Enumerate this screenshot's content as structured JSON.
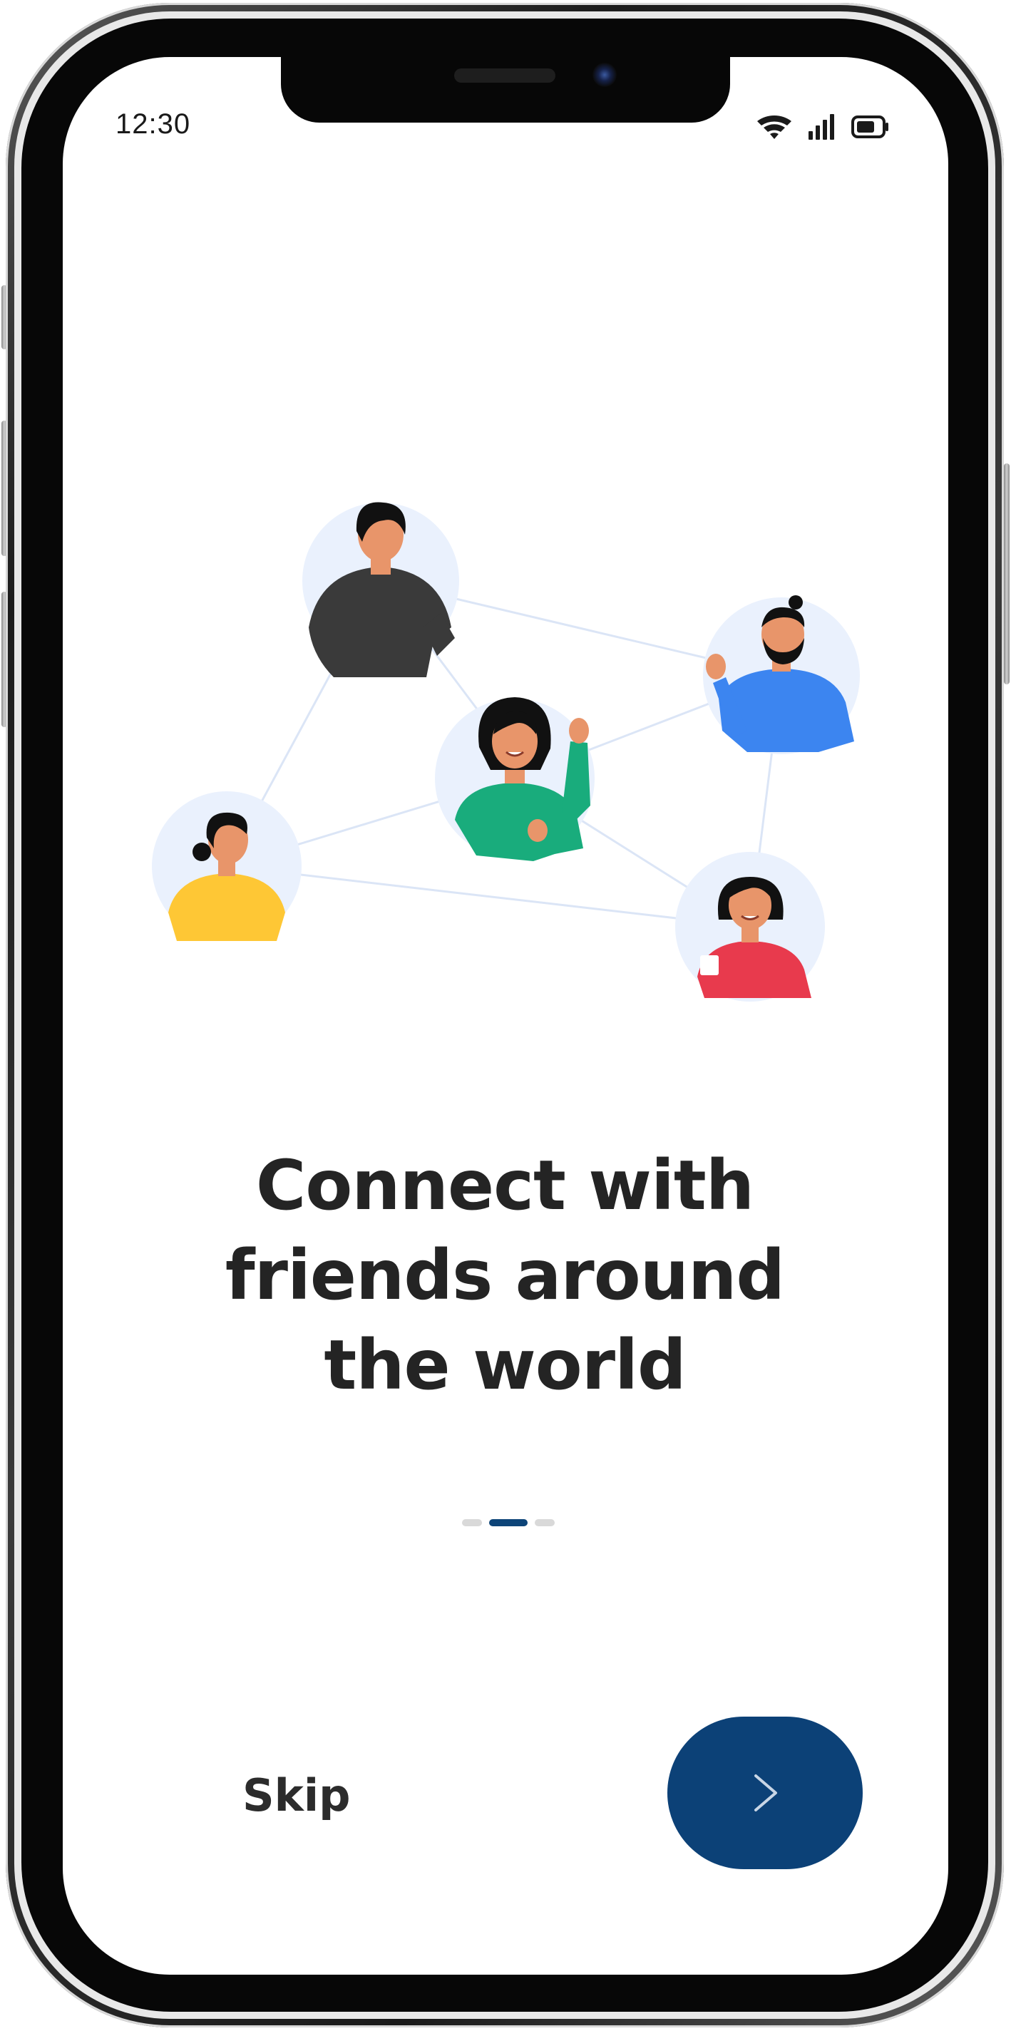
{
  "status_bar": {
    "time": "12:30",
    "icons": [
      "wifi-icon",
      "signal-icon",
      "battery-icon"
    ]
  },
  "onboarding": {
    "headline_lines": [
      "Connect with",
      "friends around",
      "the world"
    ],
    "page_indicator": {
      "total": 3,
      "current": 2
    },
    "skip_label": "Skip",
    "next_icon": "chevron-right-icon"
  },
  "illustration": {
    "people": [
      "person-dark-shirt",
      "person-blue-shirt",
      "person-green-shirt",
      "person-yellow-shirt",
      "person-red-shirt"
    ]
  },
  "colors": {
    "accent": "#0c4177",
    "headline": "#242424",
    "dot_inactive": "#d9d9d9",
    "avatar_bg": "#eaf1fd",
    "connector": "#dbe5f6"
  }
}
